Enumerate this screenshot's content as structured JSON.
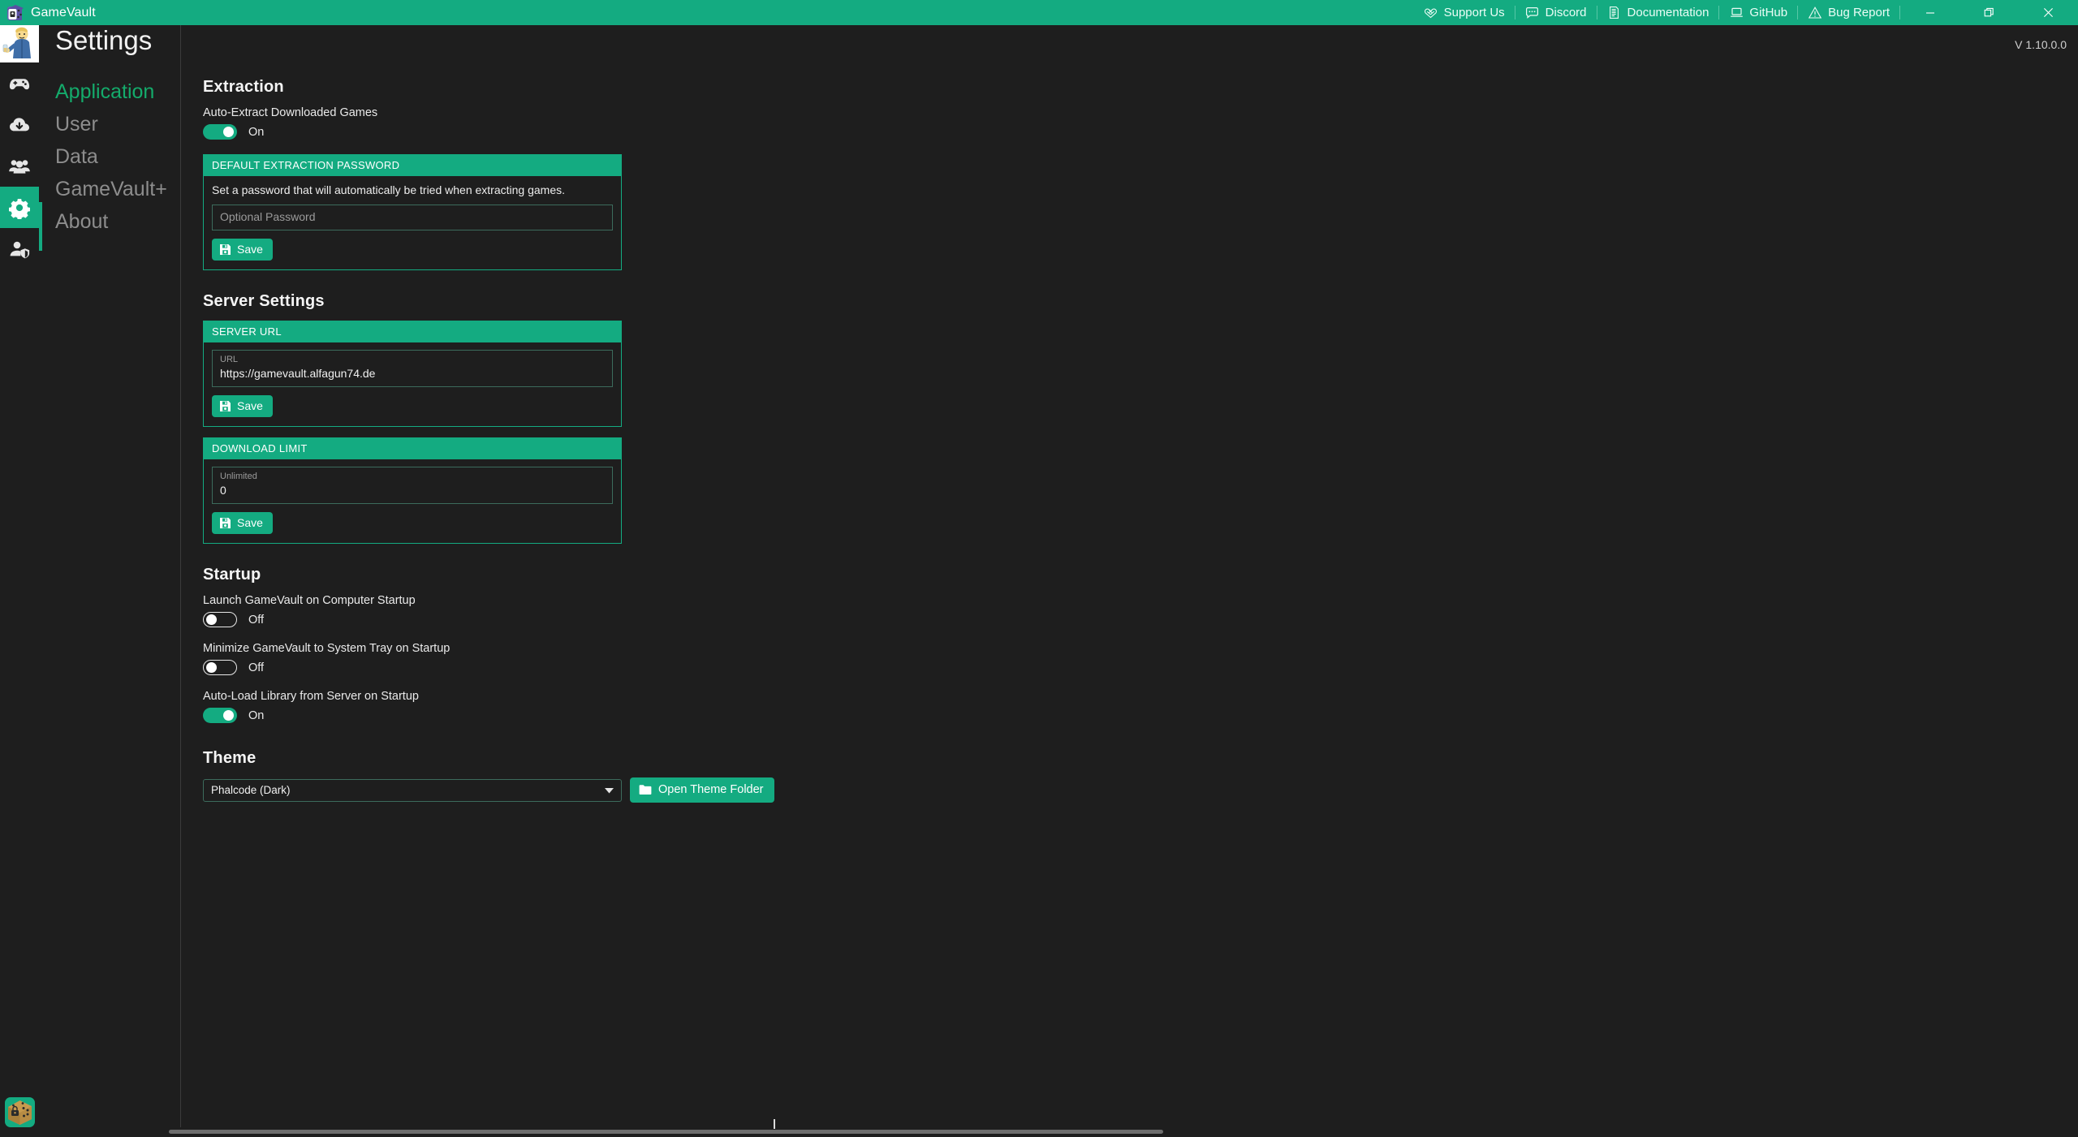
{
  "titlebar": {
    "app_name": "GameVault",
    "app_icon": "dice-lock-icon",
    "links": [
      {
        "label": "Support Us",
        "icon": "hands-heart-icon"
      },
      {
        "label": "Discord",
        "icon": "chat-bubble-icon"
      },
      {
        "label": "Documentation",
        "icon": "document-icon"
      },
      {
        "label": "GitHub",
        "icon": "laptop-icon"
      },
      {
        "label": "Bug Report",
        "icon": "warning-triangle-icon"
      }
    ],
    "window_controls": {
      "minimize": "minimize-icon",
      "maximize": "maximize-icon",
      "close": "close-icon"
    },
    "accent_color": "#14ab81"
  },
  "rail": {
    "avatar": "vault-boy-avatar",
    "items": [
      {
        "name": "games",
        "icon": "gamepad-icon",
        "active": false
      },
      {
        "name": "downloads",
        "icon": "cloud-download-icon",
        "active": false
      },
      {
        "name": "community",
        "icon": "people-icon",
        "active": false
      },
      {
        "name": "settings",
        "icon": "gear-icon",
        "active": true
      },
      {
        "name": "admin",
        "icon": "user-shield-icon",
        "active": false
      }
    ],
    "bottom_logo": "gamevault-dice-logo"
  },
  "header": {
    "title": "Settings",
    "version": "V 1.10.0.0"
  },
  "nav": {
    "items": [
      {
        "label": "Application",
        "active": true
      },
      {
        "label": "User",
        "active": false
      },
      {
        "label": "Data",
        "active": false
      },
      {
        "label": "GameVault+",
        "active": false
      },
      {
        "label": "About",
        "active": false
      }
    ]
  },
  "extraction": {
    "section_title": "Extraction",
    "auto_extract": {
      "label": "Auto-Extract Downloaded Games",
      "state": "On",
      "on": true
    },
    "password_card": {
      "header": "DEFAULT EXTRACTION PASSWORD",
      "description": "Set a password that will automatically be tried when extracting games.",
      "input_placeholder": "Optional Password",
      "input_value": "",
      "save_label": "Save",
      "save_icon": "floppy-disk-icon"
    }
  },
  "server": {
    "section_title": "Server Settings",
    "url_card": {
      "header": "SERVER URL",
      "input_label": "URL",
      "input_value": "https://gamevault.alfagun74.de",
      "save_label": "Save",
      "save_icon": "floppy-disk-icon"
    },
    "download_limit_card": {
      "header": "DOWNLOAD LIMIT",
      "input_label": "Unlimited",
      "input_value": "0",
      "save_label": "Save",
      "save_icon": "floppy-disk-icon"
    }
  },
  "startup": {
    "section_title": "Startup",
    "toggles": [
      {
        "label": "Launch GameVault on Computer Startup",
        "state": "Off",
        "on": false
      },
      {
        "label": "Minimize GameVault to System Tray on Startup",
        "state": "Off",
        "on": false
      },
      {
        "label": "Auto-Load Library from Server on Startup",
        "state": "On",
        "on": true
      }
    ]
  },
  "theme": {
    "section_title": "Theme",
    "selected": "Phalcode (Dark)",
    "open_folder_label": "Open Theme Folder",
    "open_folder_icon": "folder-icon"
  }
}
